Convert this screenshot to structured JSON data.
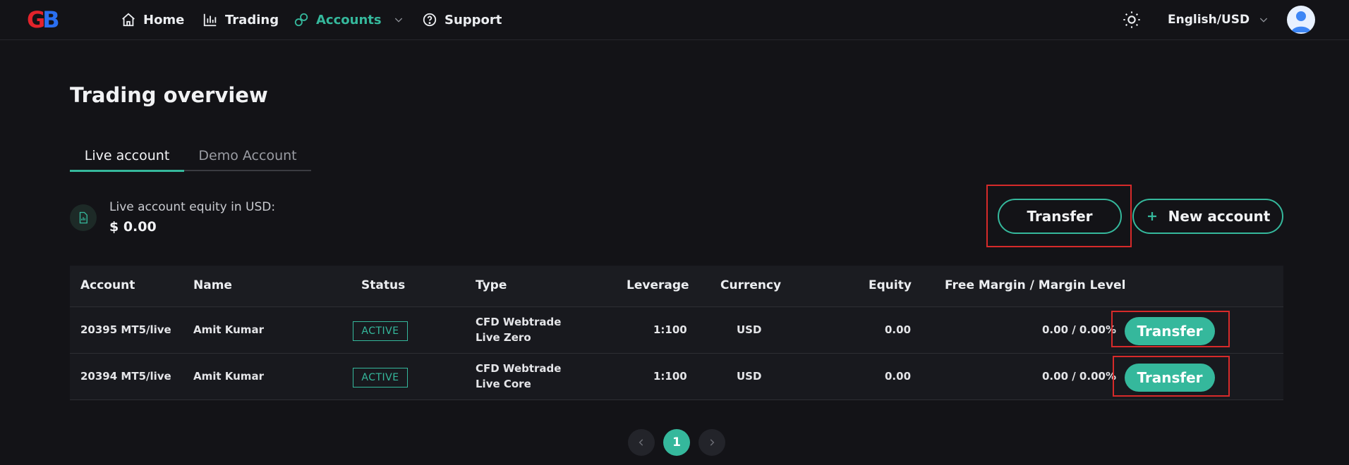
{
  "logo": {
    "g": "G",
    "b": "B"
  },
  "nav": {
    "home": "Home",
    "trading": "Trading",
    "accounts": "Accounts",
    "support": "Support",
    "language": "English/USD"
  },
  "colors": {
    "accent": "#35b89c",
    "highlight": "#d62a2a",
    "background": "#131317"
  },
  "page": {
    "title": "Trading overview",
    "tabs": [
      "Live account",
      "Demo Account"
    ],
    "active_tab": "Live account",
    "equity_label": "Live account equity in USD:",
    "equity_value": "$ 0.00",
    "transfer_button": "Transfer",
    "new_account_button": "New account"
  },
  "table": {
    "headers": [
      "Account",
      "Name",
      "Status",
      "Type",
      "Leverage",
      "Currency",
      "Equity",
      "Free Margin / Margin Level"
    ],
    "rows": [
      {
        "account": "20395 MT5/live",
        "name": "Amit Kumar",
        "status": "ACTIVE",
        "type_line1": "CFD Webtrade",
        "type_line2": "Live Zero",
        "leverage": "1:100",
        "currency": "USD",
        "equity": "0.00",
        "margin": "0.00 / 0.00%",
        "action": "Transfer"
      },
      {
        "account": "20394 MT5/live",
        "name": "Amit Kumar",
        "status": "ACTIVE",
        "type_line1": "CFD Webtrade",
        "type_line2": "Live Core",
        "leverage": "1:100",
        "currency": "USD",
        "equity": "0.00",
        "margin": "0.00 / 0.00%",
        "action": "Transfer"
      }
    ]
  },
  "pagination": {
    "current": "1",
    "prev_icon": "chevron-left-icon",
    "next_icon": "chevron-right-icon"
  }
}
